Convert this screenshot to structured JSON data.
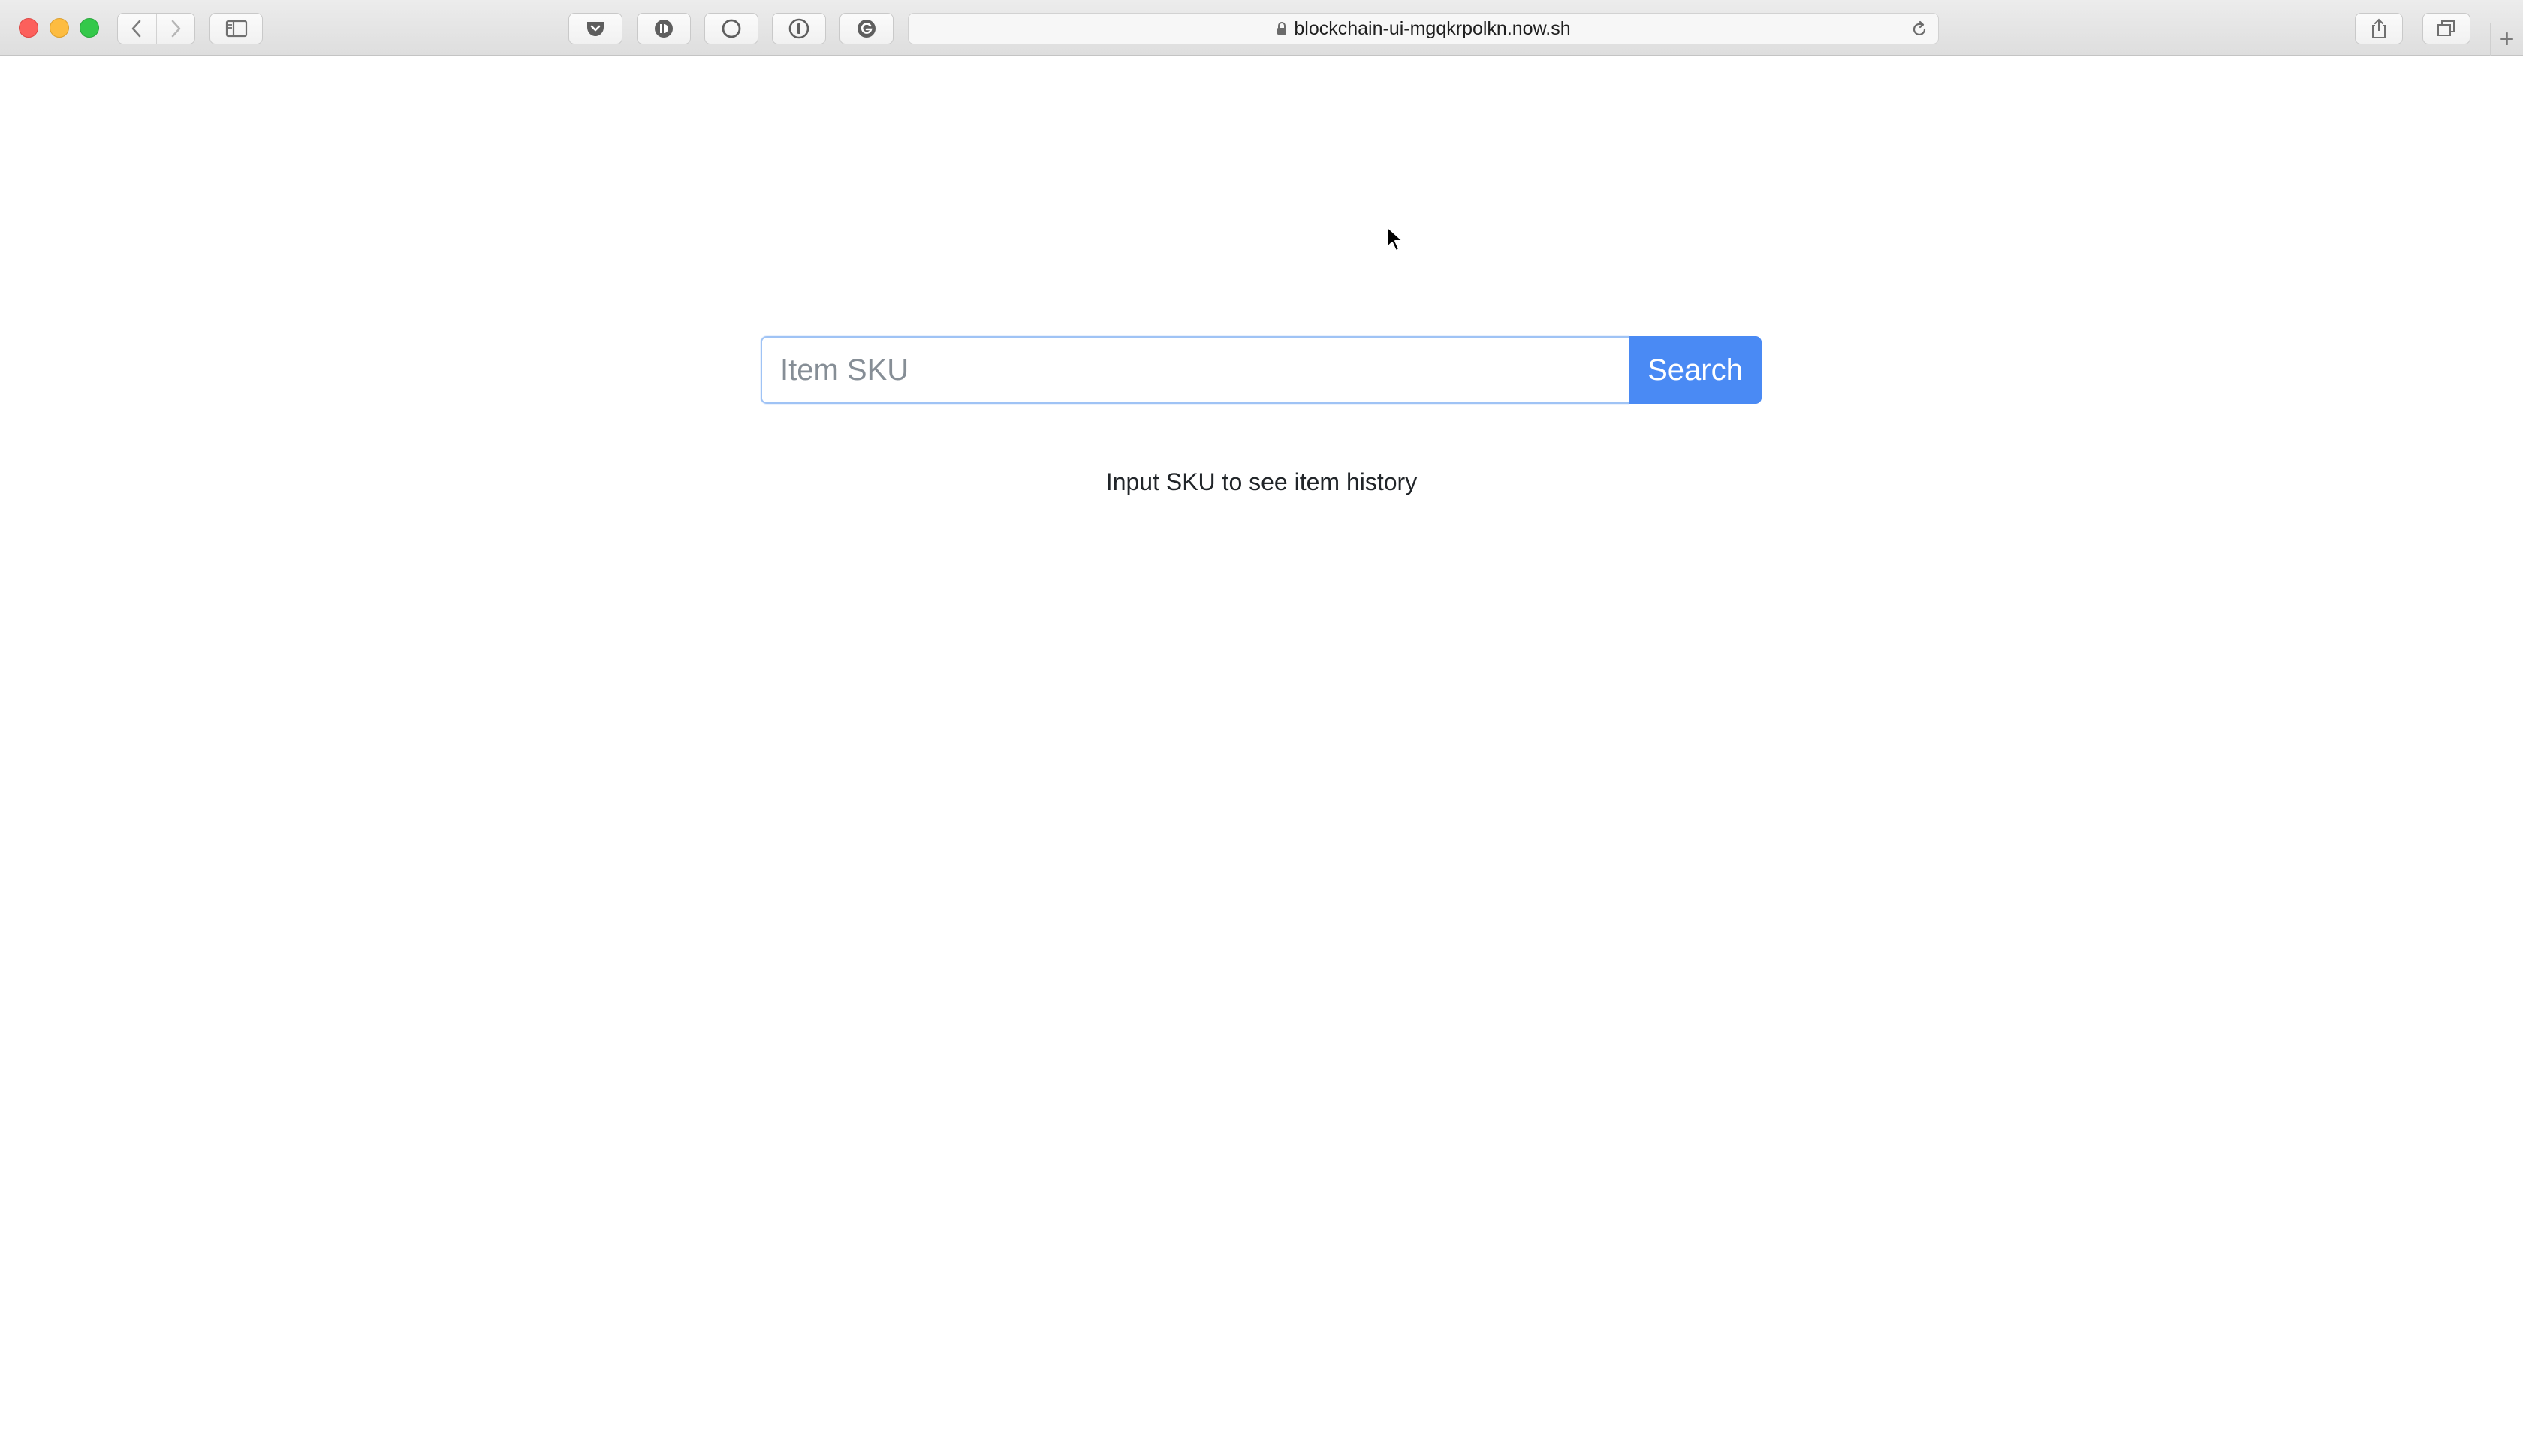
{
  "browser": {
    "url": "blockchain-ui-mgqkrpolkn.now.sh",
    "new_tab_symbol": "+"
  },
  "search": {
    "placeholder": "Item SKU",
    "value": "",
    "button_label": "Search"
  },
  "hint": {
    "text": "Input SKU to see item history"
  },
  "colors": {
    "accent": "#4a8af4",
    "input_focus_border": "#9fc3f5"
  }
}
